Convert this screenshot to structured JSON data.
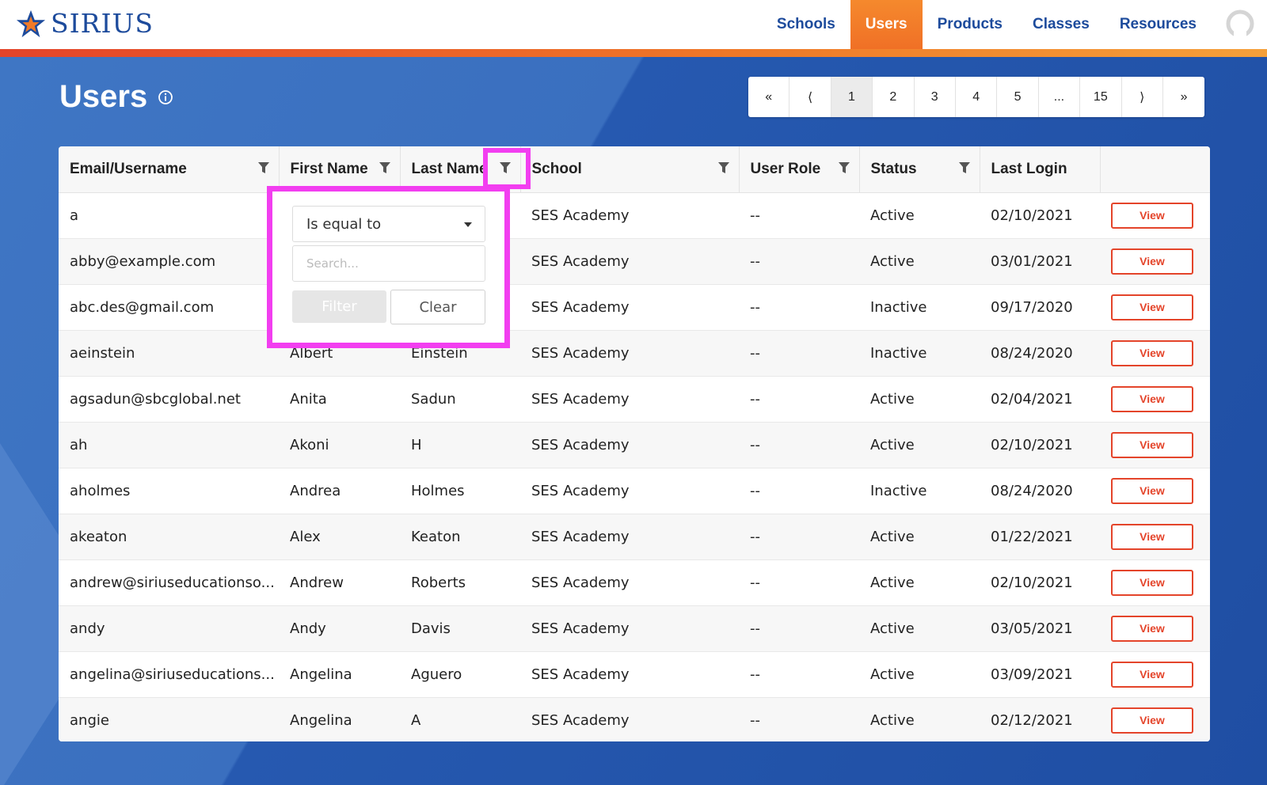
{
  "app": {
    "brand": "SIRIUS",
    "nav": [
      {
        "label": "Schools",
        "active": false
      },
      {
        "label": "Users",
        "active": true
      },
      {
        "label": "Products",
        "active": false
      },
      {
        "label": "Classes",
        "active": false
      },
      {
        "label": "Resources",
        "active": false
      }
    ]
  },
  "page": {
    "title": "Users"
  },
  "pagination": [
    "«",
    "⟨",
    "1",
    "2",
    "3",
    "4",
    "5",
    "...",
    "15",
    "⟩",
    "»"
  ],
  "pagination_current": "1",
  "table": {
    "columns": [
      "Email/Username",
      "First Name",
      "Last Name",
      "School",
      "User Role",
      "Status",
      "Last Login",
      ""
    ],
    "rows": [
      [
        "a",
        "",
        "",
        "SES Academy",
        "--",
        "Active",
        "02/10/2021"
      ],
      [
        "abby@example.com",
        "",
        "",
        "SES Academy",
        "--",
        "Active",
        "03/01/2021"
      ],
      [
        "abc.des@gmail.com",
        "",
        "",
        "SES Academy",
        "--",
        "Inactive",
        "09/17/2020"
      ],
      [
        "aeinstein",
        "Albert",
        "Einstein",
        "SES Academy",
        "--",
        "Inactive",
        "08/24/2020"
      ],
      [
        "agsadun@sbcglobal.net",
        "Anita",
        "Sadun",
        "SES Academy",
        "--",
        "Active",
        "02/04/2021"
      ],
      [
        "ah",
        "Akoni",
        "H",
        "SES Academy",
        "--",
        "Active",
        "02/10/2021"
      ],
      [
        "aholmes",
        "Andrea",
        "Holmes",
        "SES Academy",
        "--",
        "Inactive",
        "08/24/2020"
      ],
      [
        "akeaton",
        "Alex",
        "Keaton",
        "SES Academy",
        "--",
        "Active",
        "01/22/2021"
      ],
      [
        "andrew@siriuseducationso...",
        "Andrew",
        "Roberts",
        "SES Academy",
        "--",
        "Active",
        "02/10/2021"
      ],
      [
        "andy",
        "Andy",
        "Davis",
        "SES Academy",
        "--",
        "Active",
        "03/05/2021"
      ],
      [
        "angelina@siriuseducations...",
        "Angelina",
        "Aguero",
        "SES Academy",
        "--",
        "Active",
        "03/09/2021"
      ],
      [
        "angie",
        "Angelina",
        "A",
        "SES Academy",
        "--",
        "Active",
        "02/12/2021"
      ]
    ],
    "action_label": "View"
  },
  "filter_popup": {
    "operator": "Is equal to",
    "search_placeholder": "Search...",
    "filter_label": "Filter",
    "clear_label": "Clear"
  },
  "colors": {
    "brand_blue": "#1d4b9c",
    "accent_orange": "#f07026",
    "action_red": "#e4442a",
    "highlight_magenta": "#f23ef0"
  }
}
